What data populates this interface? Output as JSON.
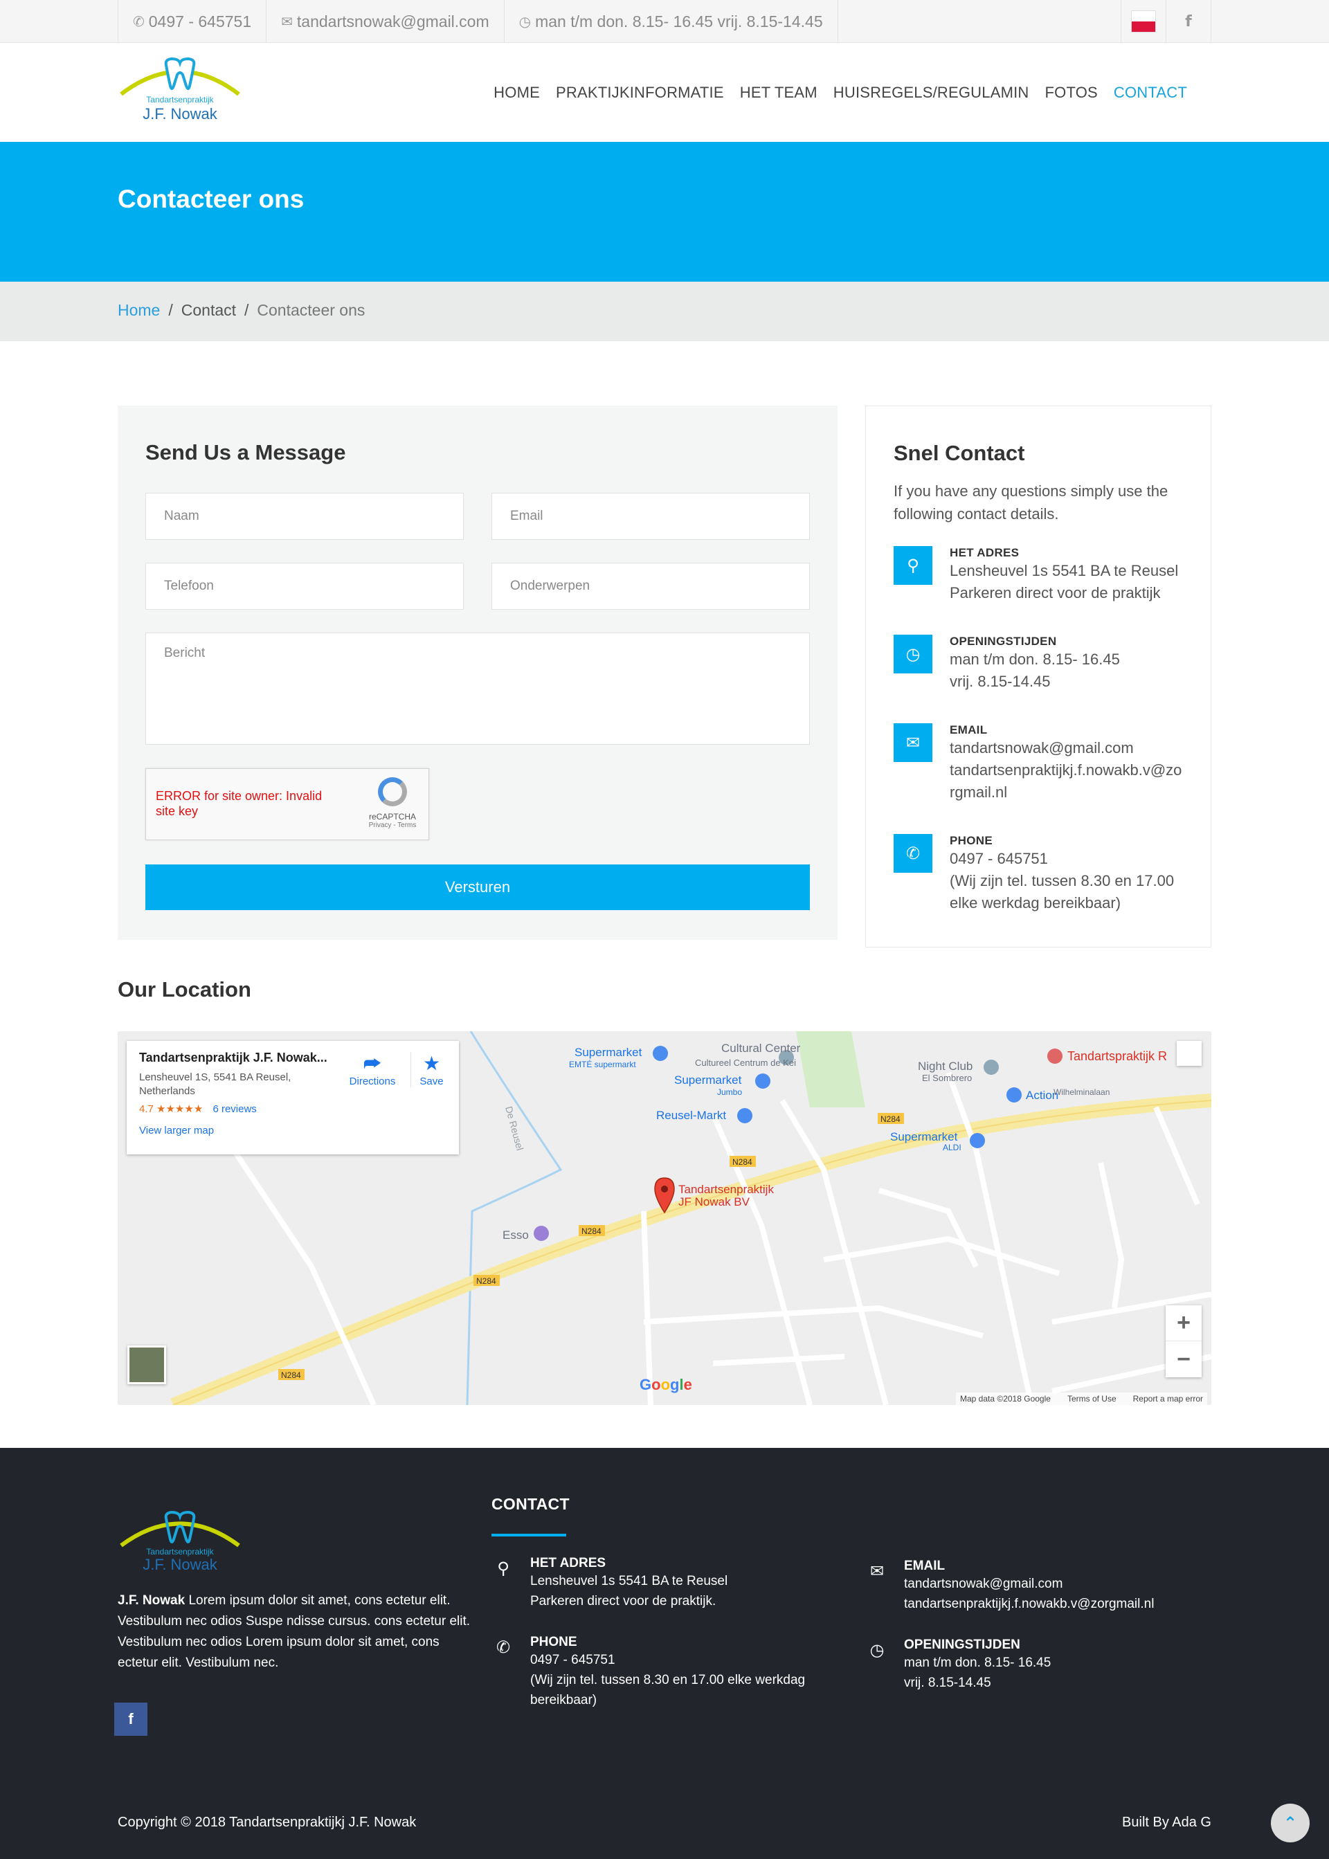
{
  "topbar": {
    "phone": "0497 - 645751",
    "email": "tandartsnowak@gmail.com",
    "hours": "man t/m don. 8.15- 16.45 vrij. 8.15-14.45"
  },
  "logo": {
    "line1": "Tandartsenpraktijk",
    "line2": "J.F. Nowak"
  },
  "nav": [
    "HOME",
    "PRAKTIJKINFORMATIE",
    "HET TEAM",
    "HUISREGELS/REGULAMIN",
    "FOTOS",
    "CONTACT"
  ],
  "banner": {
    "title": "Contacteer ons"
  },
  "breadcrumb": {
    "home": "Home",
    "sep": "/",
    "middle": "Contact",
    "current": "Contacteer ons"
  },
  "form": {
    "title": "Send Us a Message",
    "naam": "Naam",
    "email": "Email",
    "telefoon": "Telefoon",
    "onderwerpen": "Onderwerpen",
    "bericht": "Bericht",
    "captcha_error": "ERROR for site owner: Invalid site key",
    "captcha_brand": "reCAPTCHA",
    "captcha_links": "Privacy - Terms",
    "submit": "Versturen"
  },
  "quick": {
    "title": "Snel Contact",
    "intro": "If you have any questions simply use the following contact details.",
    "items": [
      {
        "label": "HET ADRES",
        "lines": [
          "Lensheuvel 1s 5541 BA te Reusel",
          "Parkeren direct voor de praktijk"
        ]
      },
      {
        "label": "OPENINGSTIJDEN",
        "lines": [
          "man t/m don. 8.15- 16.45",
          "vrij. 8.15-14.45"
        ]
      },
      {
        "label": "EMAIL",
        "lines": [
          "tandartsnowak@gmail.com",
          "tandartsenpraktijkj.f.nowakb.v@zorgmail.nl"
        ]
      },
      {
        "label": "PHONE",
        "lines": [
          "0497 - 645751",
          "(Wij zijn tel. tussen 8.30 en 17.00 elke werkdag bereikbaar)"
        ]
      }
    ]
  },
  "location": {
    "title": "Our Location",
    "card_title": "Tandartsenpraktijk J.F. Nowak...",
    "card_address": "Lensheuvel 1S, 5541 BA Reusel, Netherlands",
    "rating": "4.7",
    "stars": "★★★★★",
    "reviews": "6 reviews",
    "larger": "View larger map",
    "directions": "Directions",
    "save": "Save",
    "pin_label_1": "Tandartsenpraktijk",
    "pin_label_2": "JF Nowak BV",
    "labels": {
      "supermarket1": "Supermarket",
      "emte": "EMTÉ supermarkt",
      "cultural": "Cultural Center",
      "cultureel": "Cultureel Centrum de Kei",
      "supermarket2": "Supermarket",
      "jumbo": "Jumbo",
      "reuselmarkt": "Reusel-Markt",
      "nightclub": "Night Club",
      "sombrero": "El Sombrero",
      "action": "Action",
      "tandarts_r": "Tandartspraktijk R",
      "supermarket3": "Supermarket",
      "aldi": "ALDI",
      "esso": "Esso",
      "dereusel": "De Reusel",
      "wilhelminalaan": "Wilhelminalaan",
      "n284": "N284"
    },
    "google": "Google",
    "mapdata": "Map data ©2018 Google",
    "terms": "Terms of Use",
    "report": "Report a map error"
  },
  "footer": {
    "about_name": "J.F. Nowak",
    "about_text": "Lorem ipsum dolor sit amet, cons ectetur elit. Vestibulum nec odios Suspe ndisse cursus. cons ectetur elit. Vestibulum nec odios Lorem ipsum dolor sit amet, cons ectetur elit. Vestibulum nec.",
    "contact_title": "CONTACT",
    "adres_label": "HET ADRES",
    "adres_1": "Lensheuvel 1s 5541 BA te Reusel",
    "adres_2": "Parkeren direct voor de praktijk.",
    "phone_label": "PHONE",
    "phone_1": "0497 - 645751",
    "phone_2": "(Wij zijn tel. tussen 8.30 en 17.00 elke werkdag bereikbaar)",
    "email_label": "EMAIL",
    "email_1": "tandartsnowak@gmail.com",
    "email_2": "tandartsenpraktijkj.f.nowakb.v@zorgmail.nl",
    "hours_label": "OPENINGSTIJDEN",
    "hours_1": "man t/m don. 8.15- 16.45",
    "hours_2": "vrij. 8.15-14.45",
    "copyright": "Copyright © 2018 Tandartsenpraktijkj J.F. Nowak",
    "built": "Built By Ada G"
  },
  "colors": {
    "accent": "#00aeef",
    "footer_bg": "#22252c"
  }
}
